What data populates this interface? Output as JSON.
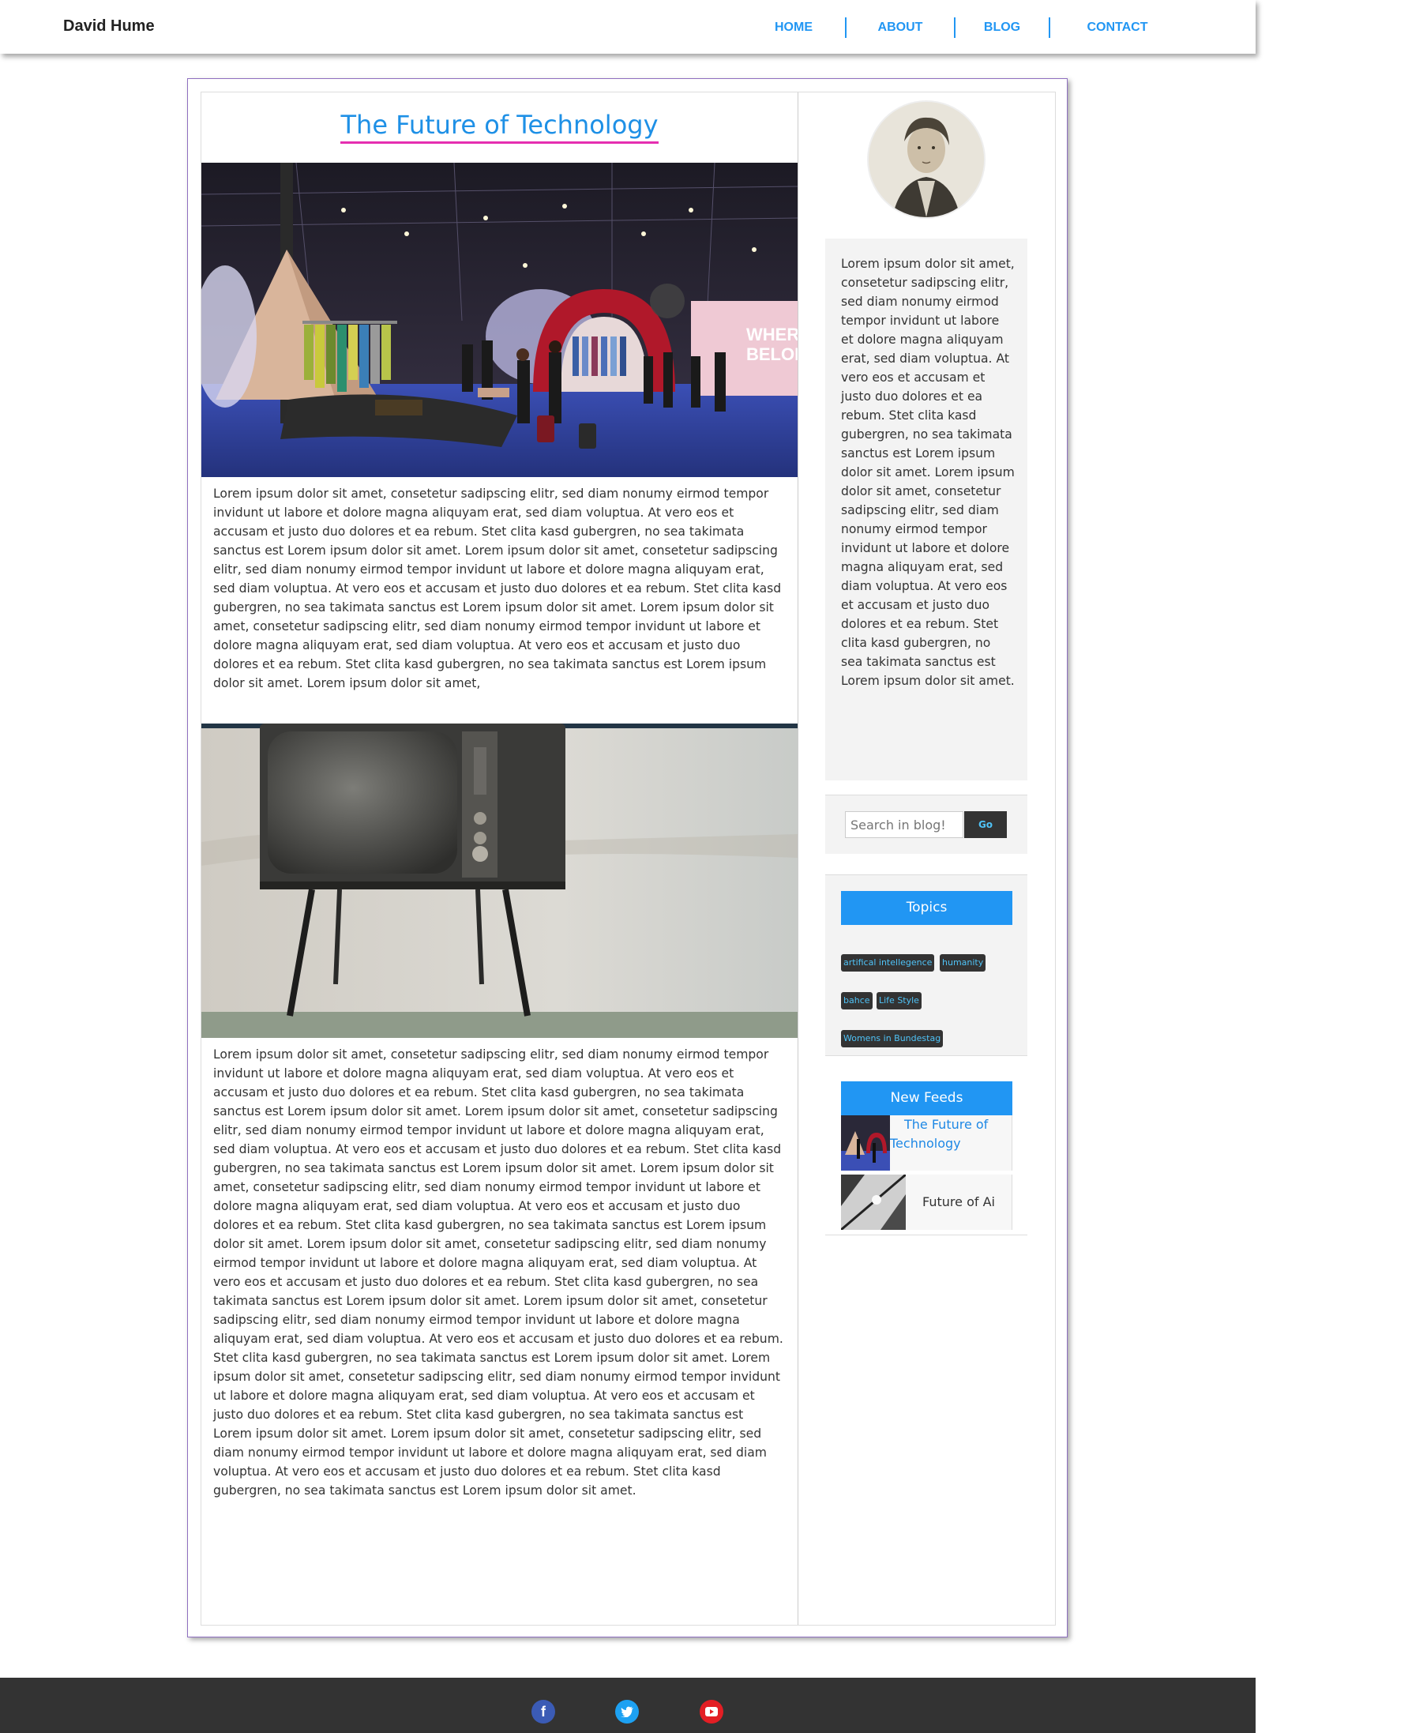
{
  "site": {
    "brand": "David Hume"
  },
  "nav": {
    "items": [
      "HOME",
      "ABOUT",
      "BLOG",
      "CONTACT"
    ]
  },
  "post": {
    "title": "The Future of Technology",
    "para1": "Lorem ipsum dolor sit amet, consetetur sadipscing elitr, sed diam nonumy eirmod tempor invidunt ut labore et dolore magna aliquyam erat, sed diam voluptua. At vero eos et accusam et justo duo dolores et ea rebum. Stet clita kasd gubergren, no sea takimata sanctus est Lorem ipsum dolor sit amet. Lorem ipsum dolor sit amet, consetetur sadipscing elitr, sed diam nonumy eirmod tempor invidunt ut labore et dolore magna aliquyam erat, sed diam voluptua. At vero eos et accusam et justo duo dolores et ea rebum. Stet clita kasd gubergren, no sea takimata sanctus est Lorem ipsum dolor sit amet. Lorem ipsum dolor sit amet, consetetur sadipscing elitr, sed diam nonumy eirmod tempor invidunt ut labore et dolore magna aliquyam erat, sed diam voluptua. At vero eos et accusam et justo duo dolores et ea rebum. Stet clita kasd gubergren, no sea takimata sanctus est Lorem ipsum dolor sit amet. Lorem ipsum dolor sit amet,",
    "para2": "Lorem ipsum dolor sit amet, consetetur sadipscing elitr, sed diam nonumy eirmod tempor invidunt ut labore et dolore magna aliquyam erat, sed diam voluptua. At vero eos et accusam et justo duo dolores et ea rebum. Stet clita kasd gubergren, no sea takimata sanctus est Lorem ipsum dolor sit amet. Lorem ipsum dolor sit amet, consetetur sadipscing elitr, sed diam nonumy eirmod tempor invidunt ut labore et dolore magna aliquyam erat, sed diam voluptua. At vero eos et accusam et justo duo dolores et ea rebum. Stet clita kasd gubergren, no sea takimata sanctus est Lorem ipsum dolor sit amet. Lorem ipsum dolor sit amet, consetetur sadipscing elitr, sed diam nonumy eirmod tempor invidunt ut labore et dolore magna aliquyam erat, sed diam voluptua. At vero eos et accusam et justo duo dolores et ea rebum. Stet clita kasd gubergren, no sea takimata sanctus est Lorem ipsum dolor sit amet. Lorem ipsum dolor sit amet, consetetur sadipscing elitr, sed diam nonumy eirmod tempor invidunt ut labore et dolore magna aliquyam erat, sed diam voluptua. At vero eos et accusam et justo duo dolores et ea rebum. Stet clita kasd gubergren, no sea takimata sanctus est Lorem ipsum dolor sit amet. Lorem ipsum dolor sit amet, consetetur sadipscing elitr, sed diam nonumy eirmod tempor invidunt ut labore et dolore magna aliquyam erat, sed diam voluptua. At vero eos et accusam et justo duo dolores et ea rebum. Stet clita kasd gubergren, no sea takimata sanctus est Lorem ipsum dolor sit amet. Lorem ipsum dolor sit amet, consetetur sadipscing elitr, sed diam nonumy eirmod tempor invidunt ut labore et dolore magna aliquyam erat, sed diam voluptua. At vero eos et accusam et justo duo dolores et ea rebum. Stet clita kasd gubergren, no sea takimata sanctus est Lorem ipsum dolor sit amet. Lorem ipsum dolor sit amet, consetetur sadipscing elitr, sed diam nonumy eirmod tempor invidunt ut labore et dolore magna aliquyam erat, sed diam voluptua. At vero eos et accusam et justo duo dolores et ea rebum. Stet clita kasd gubergren, no sea takimata sanctus est Lorem ipsum dolor sit amet."
  },
  "sidebar": {
    "about": "Lorem ipsum dolor sit amet, consetetur sadipscing elitr, sed diam nonumy eirmod tempor invidunt ut labore et dolore magna aliquyam erat, sed diam voluptua. At vero eos et accusam et justo duo dolores et ea rebum. Stet clita kasd gubergren, no sea takimata sanctus est Lorem ipsum dolor sit amet. Lorem ipsum dolor sit amet, consetetur sadipscing elitr, sed diam nonumy eirmod tempor invidunt ut labore et dolore magna aliquyam erat, sed diam voluptua. At vero eos et accusam et justo duo dolores et ea rebum. Stet clita kasd gubergren, no sea takimata sanctus est Lorem ipsum dolor sit amet.",
    "search": {
      "placeholder": "Search in blog!",
      "button": "Go"
    },
    "topics": {
      "title": "Topics",
      "tags": [
        "artifical intellegence",
        "humanity",
        "bahce",
        "Life Style",
        "Womens in Bundestag"
      ]
    },
    "feeds": {
      "title": "New Feeds",
      "items": [
        "The Future of Technology",
        "Future of Ai"
      ]
    }
  },
  "footer": {
    "icons": [
      "facebook-icon",
      "twitter-icon",
      "youtube-icon"
    ]
  },
  "colors": {
    "accent": "#2196f3",
    "title_underline": "#e52fb0",
    "footer": "#333333",
    "frame_border": "#8e6fbf"
  }
}
